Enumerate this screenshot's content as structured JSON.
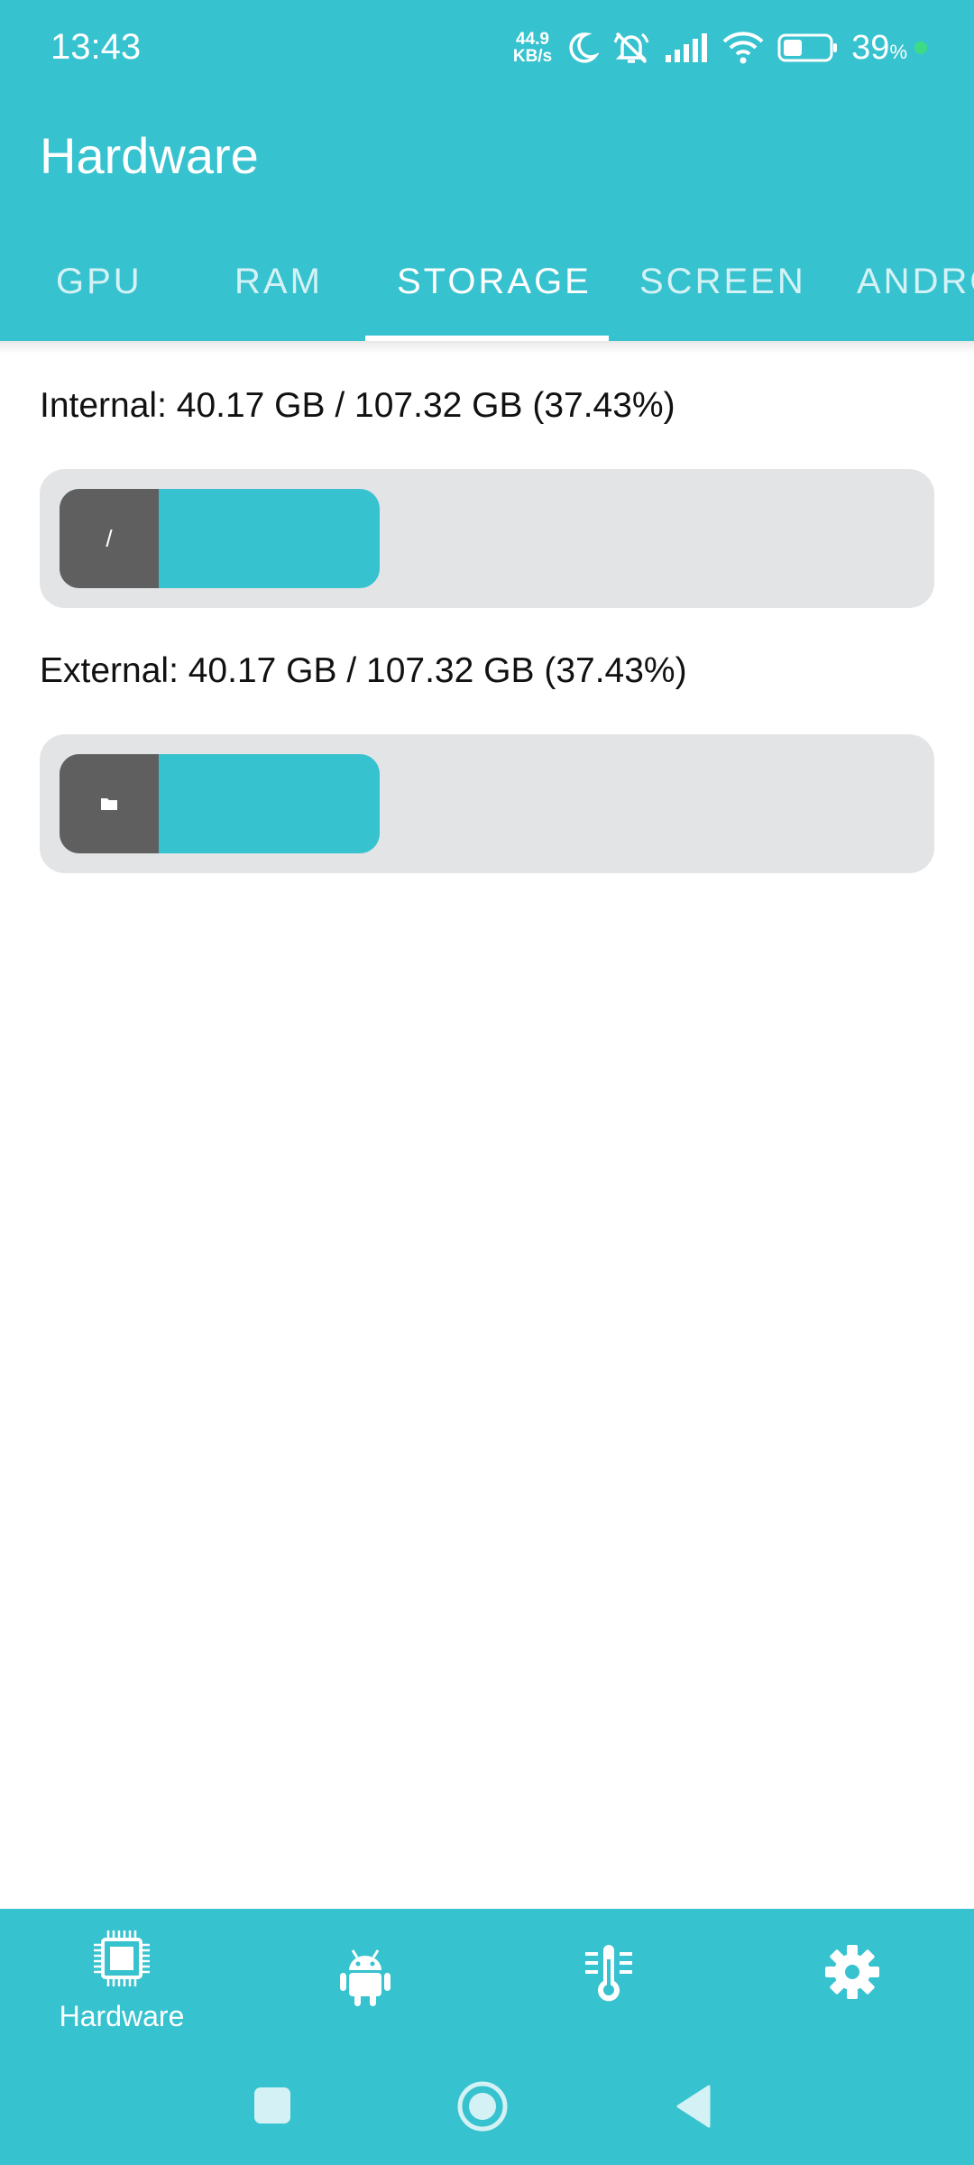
{
  "status_bar": {
    "time": "13:43",
    "net_speed_value": "44.9",
    "net_speed_unit": "KB/s",
    "battery_percent": "39",
    "battery_symbol": "%",
    "icons": [
      "moon-icon",
      "silent-bell-icon",
      "signal-icon",
      "wifi-icon",
      "battery-icon"
    ]
  },
  "app_bar": {
    "title": "Hardware"
  },
  "tabs": [
    {
      "label": "GPU",
      "active": false
    },
    {
      "label": "RAM",
      "active": false
    },
    {
      "label": "STORAGE",
      "active": true
    },
    {
      "label": "SCREEN",
      "active": false
    },
    {
      "label": "ANDROID",
      "active": false
    }
  ],
  "storage": {
    "internal": {
      "label": "Internal: 40.17 GB / 107.32 GB (37.43%)",
      "icon_text": "/",
      "used_fraction": 0.3743
    },
    "external": {
      "label": "External: 40.17 GB / 107.32 GB (37.43%)",
      "icon": "folder-icon",
      "used_fraction": 0.3743
    }
  },
  "bottom_nav": [
    {
      "label": "Hardware",
      "icon": "chip-icon",
      "active": true
    },
    {
      "label": "",
      "icon": "android-icon",
      "active": false
    },
    {
      "label": "",
      "icon": "thermometer-icon",
      "active": false
    },
    {
      "label": "",
      "icon": "gear-icon",
      "active": false
    }
  ],
  "colors": {
    "primary": "#37c2cf",
    "track": "#e3e4e6",
    "icon_block": "#5f5f5f",
    "text": "#111111"
  }
}
